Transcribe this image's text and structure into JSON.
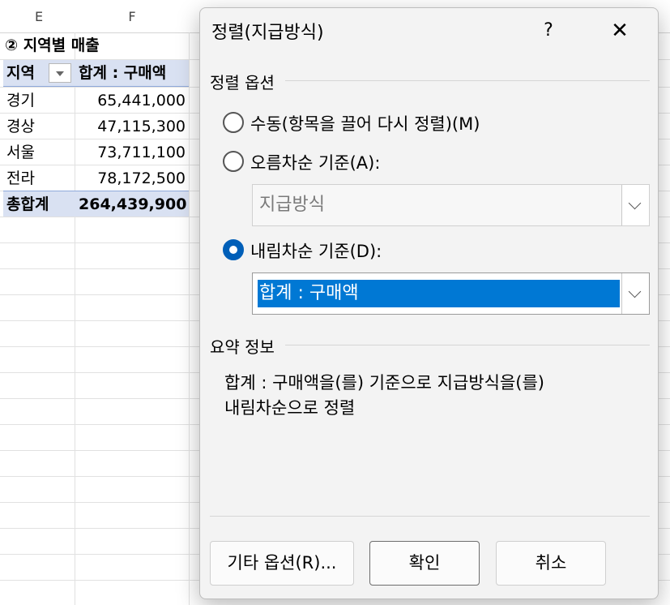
{
  "sheet": {
    "columns": [
      "E",
      "F"
    ],
    "pivot": {
      "title": "② 지역별 매출",
      "header_region": "지역",
      "header_sum": "합계 : 구매액",
      "rows": [
        {
          "region": "경기",
          "value": "65,441,000"
        },
        {
          "region": "경상",
          "value": "47,115,300"
        },
        {
          "region": "서울",
          "value": "73,711,100"
        },
        {
          "region": "전라",
          "value": "78,172,500"
        }
      ],
      "total_label": "총합계",
      "total_value": "264,439,900"
    }
  },
  "dialog": {
    "title": "정렬(지급방식)",
    "help": "?",
    "close": "✕",
    "options_group": "정렬 옵션",
    "manual_label": "수동(항목을 끌어 다시 정렬)(M)",
    "ascending_label": "오름차순 기준(A):",
    "ascending_value": "지급방식",
    "descending_label": "내림차순 기준(D):",
    "descending_value": "합계 : 구매액",
    "selected_option": "descending",
    "summary_group": "요약 정보",
    "summary_line1": "합계 : 구매액을(를) 기준으로 지급방식을(를)",
    "summary_line2": "내림차순으로 정렬",
    "more_options_button": "기타 옵션(R)...",
    "ok_button": "확인",
    "cancel_button": "취소"
  },
  "colors": {
    "pivot_header_bg": "#d9e1f2",
    "accent": "#0078d4",
    "dialog_bg": "#f3f3f3"
  }
}
